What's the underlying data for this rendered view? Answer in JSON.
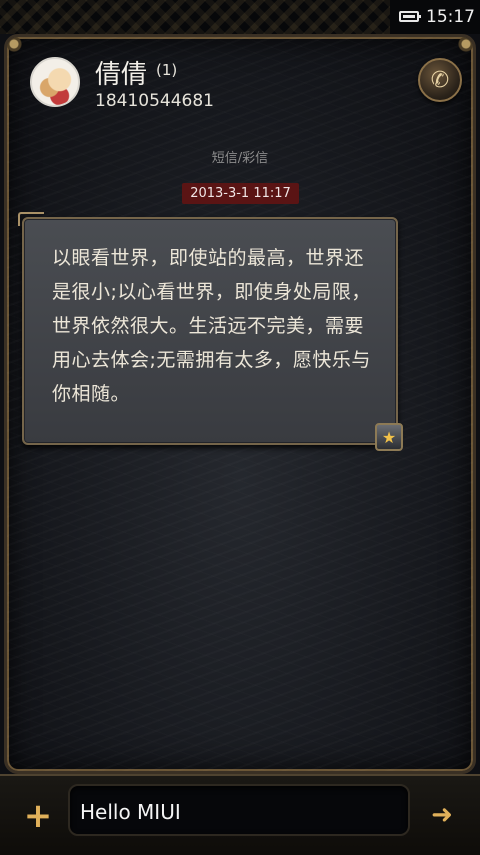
{
  "status_bar": {
    "time": "15:17",
    "battery_icon": "battery-icon"
  },
  "header": {
    "contact_name": "倩倩",
    "unread_count": "(1)",
    "phone_number": "18410544681",
    "call_icon": "phone-icon"
  },
  "thread": {
    "message_type": "短信/彩信",
    "timestamp": "2013-3-1 11:17",
    "messages": [
      {
        "text": "以眼看世界，即使站的最高，世界还是很小;以心看世界，即使身处局限，世界依然很大。生活远不完美，需要用心去体会;无需拥有太多，愿快乐与你相随。",
        "starred": true
      }
    ]
  },
  "composer": {
    "input_value": "Hello MIUI",
    "add_icon": "plus-icon",
    "send_icon": "send-arrow-icon"
  },
  "colors": {
    "accent_gold": "#e0b05a",
    "timestamp_bg": "#5a1414",
    "frame_border": "#6b5636"
  }
}
